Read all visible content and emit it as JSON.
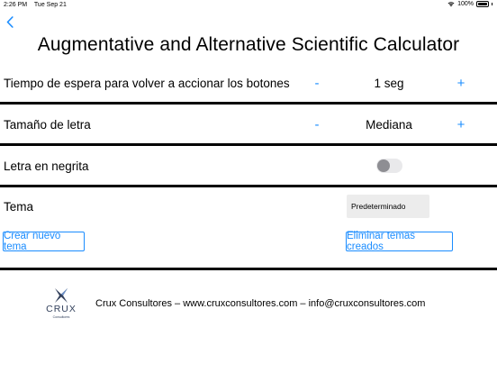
{
  "status_bar": {
    "time": "2:26 PM",
    "date": "Tue Sep 21",
    "battery": "100%"
  },
  "nav": {
    "back_icon": "chevron-left-icon"
  },
  "app": {
    "title": "Augmentative and Alternative Scientific Calculator"
  },
  "settings": {
    "wait_time": {
      "label": "Tiempo de espera para volver a accionar los botones",
      "minus": "-",
      "value": "1 seg",
      "plus": "+"
    },
    "font_size": {
      "label": "Tamaño de letra",
      "minus": "-",
      "value": "Mediana",
      "plus": "+"
    },
    "bold": {
      "label": "Letra en negrita",
      "enabled": false
    },
    "theme": {
      "label": "Tema",
      "selected": "Predeterminado",
      "create_button": "Crear nuevo tema",
      "delete_button": "Eliminar temas creados"
    }
  },
  "footer": {
    "logo_word": "CRUX",
    "logo_sub": "Consultores",
    "text": "Crux Consultores – www.cruxconsultores.com – info@cruxconsultores.com"
  },
  "colors": {
    "accent": "#1a8cff",
    "divider": "#000000",
    "toggle_off": "#e9e9eb",
    "select_bg": "#ececec",
    "logo": "#33415c"
  }
}
